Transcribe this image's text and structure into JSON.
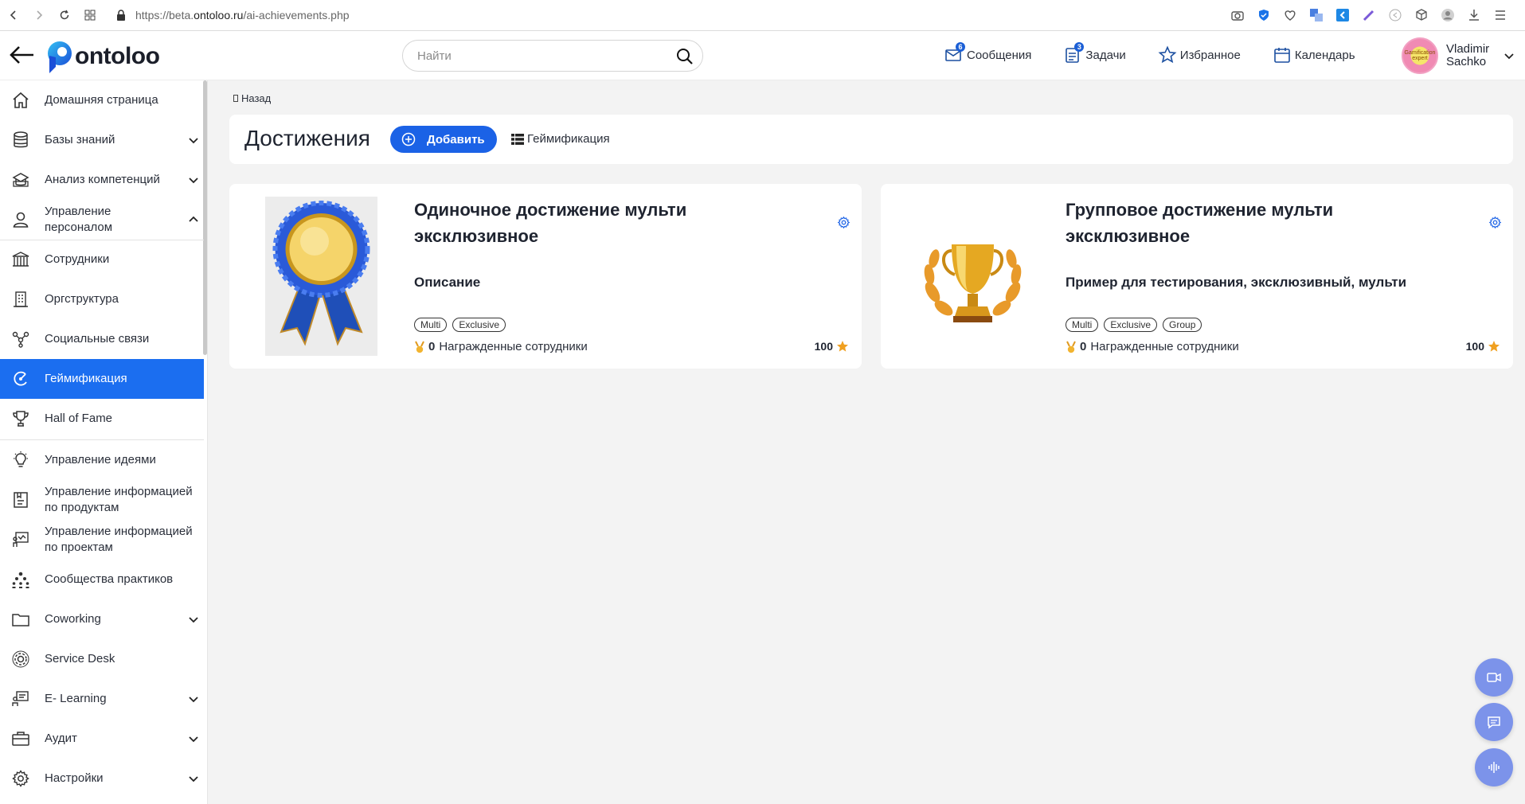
{
  "browser": {
    "url_prefix": "https://beta.",
    "url_domain": "ontoloo.ru",
    "url_path": "/ai-achievements.php"
  },
  "header": {
    "logo_text": "ontoloo",
    "search_placeholder": "Найти",
    "links": [
      {
        "label": "Сообщения",
        "badge": "6",
        "icon": "messages-icon"
      },
      {
        "label": "Задачи",
        "badge": "3",
        "icon": "tasks-icon"
      },
      {
        "label": "Избранное",
        "icon": "star-icon"
      },
      {
        "label": "Календарь",
        "icon": "calendar-icon"
      }
    ],
    "user_first": "Vladimir",
    "user_last": "Sachko",
    "avatar_text": "Gamification expert"
  },
  "sidebar": {
    "items": [
      {
        "label": "Домашняя страница",
        "icon": "home-icon"
      },
      {
        "label": "Базы знаний",
        "icon": "database-icon",
        "chevron": "down"
      },
      {
        "label": "Анализ компетенций",
        "icon": "competence-icon",
        "chevron": "down"
      },
      {
        "label": "Управление персоналом",
        "icon": "person-icon",
        "chevron": "up"
      },
      {
        "label": "Сотрудники",
        "icon": "employees-icon"
      },
      {
        "label": "Оргструктура",
        "icon": "org-structure-icon"
      },
      {
        "label": "Социальные связи",
        "icon": "social-links-icon"
      },
      {
        "label": "Геймификация",
        "icon": "gamification-icon",
        "active": true
      },
      {
        "label": "Hall of Fame",
        "icon": "trophy-icon"
      },
      {
        "label": "Управление идеями",
        "icon": "lightbulb-icon"
      },
      {
        "label": "Управление информацией по продуктам",
        "icon": "product-icon"
      },
      {
        "label": "Управление информацией по проектам",
        "icon": "project-icon"
      },
      {
        "label": "Сообщества практиков",
        "icon": "community-icon"
      },
      {
        "label": "Coworking",
        "icon": "folder-icon",
        "chevron": "down"
      },
      {
        "label": "Service Desk",
        "icon": "service-desk-icon"
      },
      {
        "label": "E- Learning",
        "icon": "elearning-icon",
        "chevron": "down"
      },
      {
        "label": "Аудит",
        "icon": "audit-icon",
        "chevron": "down"
      },
      {
        "label": "Настройки",
        "icon": "settings-icon",
        "chevron": "down"
      }
    ]
  },
  "main": {
    "breadcrumb": "Назад",
    "title": "Достижения",
    "add_button": "Добавить",
    "gamification_link": "Геймификация",
    "cards": [
      {
        "title": "Одиночное достижение мульти эксклюзивное",
        "description": "Описание",
        "tags": [
          "Multi",
          "Exclusive"
        ],
        "awarded_count": "0",
        "awarded_label": "Награжденные сотрудники",
        "points": "100",
        "image": "medal-image"
      },
      {
        "title": "Групповое достижение мульти эксклюзивное",
        "description": "Пример для тестирования, эксклюзивный, мульти",
        "tags": [
          "Multi",
          "Exclusive",
          "Group"
        ],
        "awarded_count": "0",
        "awarded_label": "Награжденные сотрудники",
        "points": "100",
        "image": "trophy-image"
      }
    ]
  },
  "colors": {
    "accent": "#1b62e6",
    "active_nav": "#1b6ef0",
    "fab": "#7c93ea",
    "star": "#f0a020"
  }
}
